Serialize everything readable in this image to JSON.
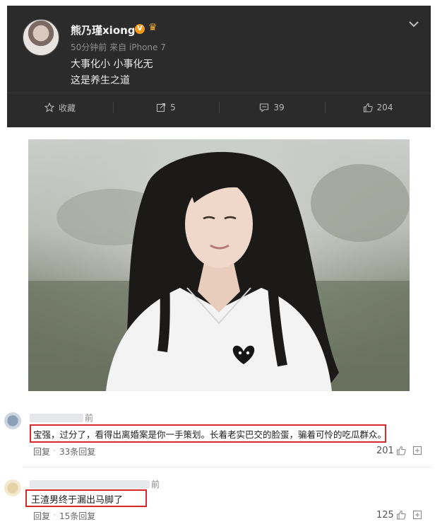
{
  "post": {
    "username": "熊乃瑾xiong",
    "verified_badge": "V",
    "meta": "50分钟前 来自 iPhone 7",
    "lines": [
      "大事化小 小事化无",
      "这是养生之道"
    ],
    "actions": {
      "favorite": "收藏",
      "repost_count": "5",
      "comment_count": "39",
      "like_count": "204"
    }
  },
  "comments": [
    {
      "time_fragment": "前",
      "text": "宝强，过分了，看得出离婚案是你一手策划。长着老实巴交的脸蛋，骗着可怜的吃瓜群众。",
      "reply_label": "回复",
      "reply_count": "33条回复",
      "likes": "201"
    },
    {
      "time_fragment": "前",
      "text": "王渣男终于漏出马脚了",
      "reply_label": "回复",
      "reply_count": "15条回复",
      "likes": "125"
    }
  ],
  "colors": {
    "post_bg": "#2b2b2b",
    "highlight_box": "#d8282c",
    "badge_orange": "#f29a1b"
  },
  "icons": [
    "chevron-down-icon",
    "star-icon",
    "repost-icon",
    "comment-icon",
    "thumb-up-icon",
    "like-icon",
    "more-icon",
    "verified-icon",
    "crown-icon"
  ]
}
